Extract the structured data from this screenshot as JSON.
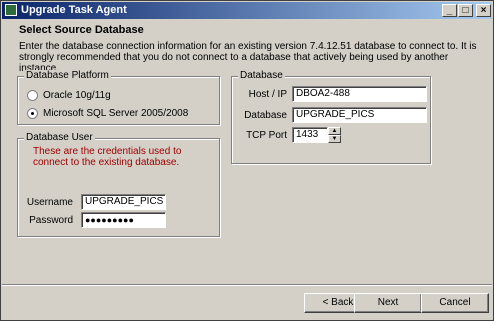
{
  "window": {
    "title": "Upgrade Task Agent",
    "controls": {
      "minimize": "_",
      "maximize": "□",
      "close": "×"
    }
  },
  "page": {
    "heading": "Select Source Database",
    "description": "Enter the database connection information for an existing version 7.4.12.51 database to connect to.  It is strongly recommended that you do not connect to a database that actively being used by another instance."
  },
  "platform": {
    "legend": "Database Platform",
    "options": [
      {
        "label": "Oracle 10g/11g",
        "selected": false
      },
      {
        "label": "Microsoft SQL Server 2005/2008",
        "selected": true
      }
    ]
  },
  "user": {
    "legend": "Database User",
    "note": "These are the credentials used to connect to the existing database.",
    "username_label": "Username",
    "username_value": "UPGRADE_PICS",
    "password_label": "Password",
    "password_value": "●●●●●●●●●"
  },
  "database": {
    "legend": "Database",
    "host_label": "Host / IP",
    "host_value": "DBOA2-488",
    "db_label": "Database",
    "db_value": "UPGRADE_PICS",
    "port_label": "TCP Port",
    "port_value": "1433"
  },
  "footer": {
    "back_label": "< Back",
    "next_label": "Next",
    "cancel_label": "Cancel"
  }
}
